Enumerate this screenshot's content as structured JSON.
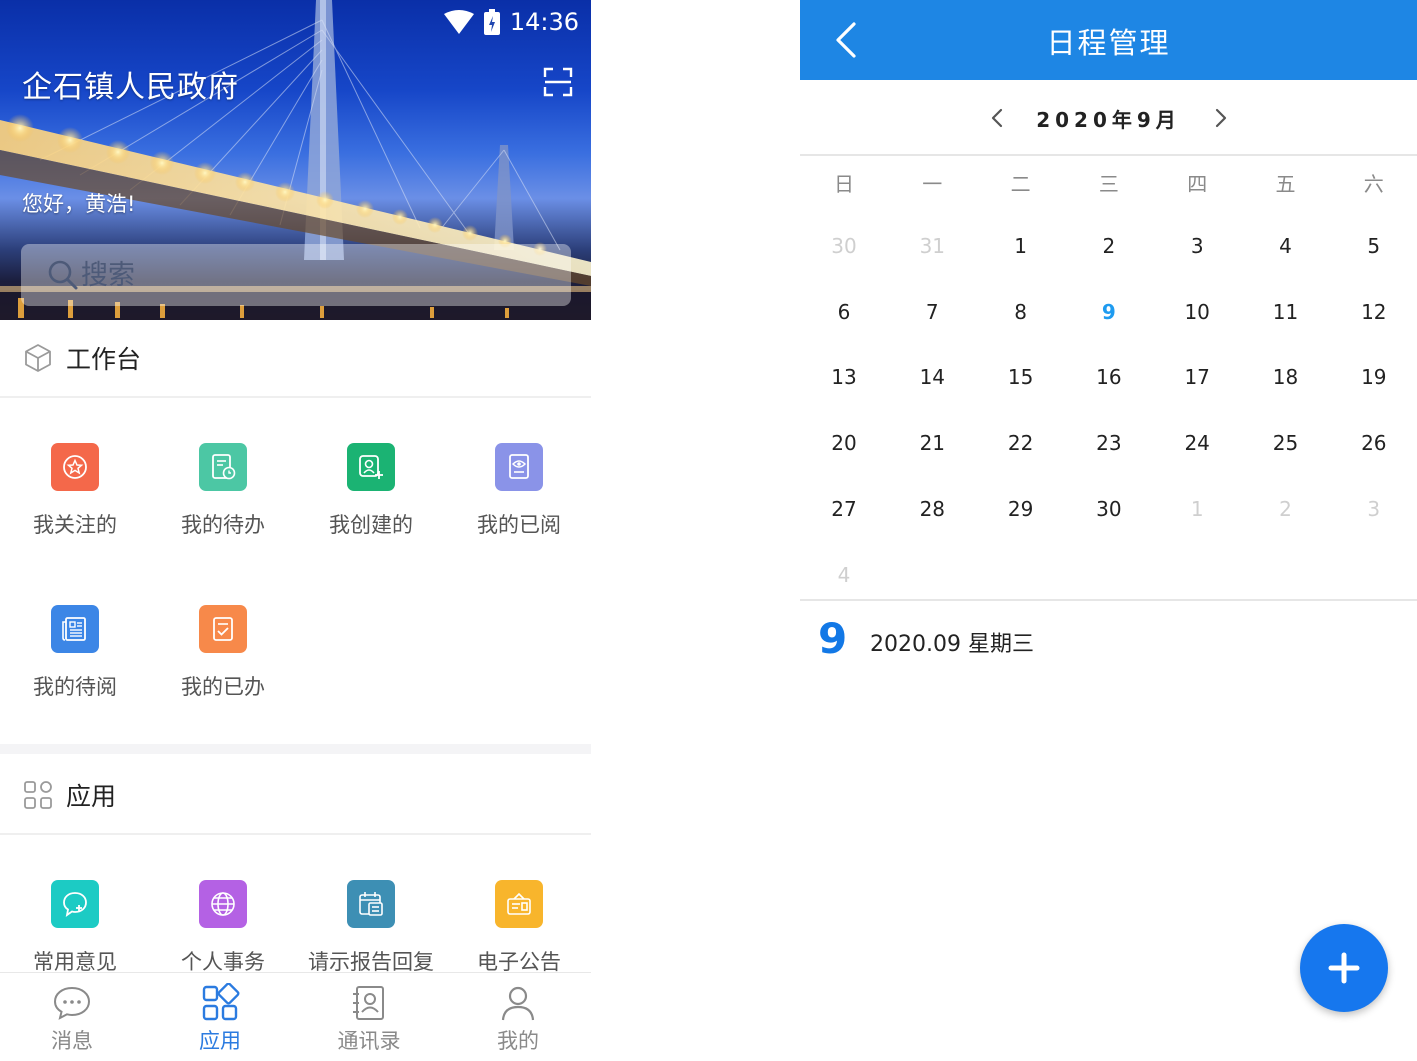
{
  "left": {
    "status": {
      "time": "14:36"
    },
    "org_title": "企石镇人民政府",
    "greeting": "您好，黄浩!",
    "search": {
      "placeholder": "搜索"
    },
    "workbench": {
      "title": "工作台",
      "items": [
        {
          "label": "我关注的",
          "icon": "star-badge-icon",
          "color": "#f4684a"
        },
        {
          "label": "我的待办",
          "icon": "doc-clock-icon",
          "color": "#4cc7a4"
        },
        {
          "label": "我创建的",
          "icon": "user-add-icon",
          "color": "#1bb373"
        },
        {
          "label": "我的已阅",
          "icon": "doc-eye-icon",
          "color": "#8a93e8"
        },
        {
          "label": "我的待阅",
          "icon": "newspaper-icon",
          "color": "#3c86e6"
        },
        {
          "label": "我的已办",
          "icon": "doc-check-icon",
          "color": "#f7894a"
        }
      ]
    },
    "apps": {
      "title": "应用",
      "items": [
        {
          "label": "常用意见",
          "icon": "chat-plus-icon",
          "color": "#1ccbc4"
        },
        {
          "label": "个人事务",
          "icon": "globe-icon",
          "color": "#b461e4"
        },
        {
          "label": "请示报告回复",
          "icon": "calendar-doc-icon",
          "color": "#3d8fb4"
        },
        {
          "label": "电子公告",
          "icon": "announcement-icon",
          "color": "#f8b52c"
        }
      ]
    },
    "tabs": [
      {
        "label": "消息",
        "icon": "message-icon",
        "active": false
      },
      {
        "label": "应用",
        "icon": "apps-grid-icon",
        "active": true
      },
      {
        "label": "通讯录",
        "icon": "contacts-icon",
        "active": false
      },
      {
        "label": "我的",
        "icon": "person-icon",
        "active": false
      }
    ]
  },
  "right": {
    "title": "日程管理",
    "month_label": "2020年9月",
    "weekdays": [
      "日",
      "一",
      "二",
      "三",
      "四",
      "五",
      "六"
    ],
    "weeks": [
      [
        "30",
        "31",
        "1",
        "2",
        "3",
        "4",
        "5"
      ],
      [
        "6",
        "7",
        "8",
        "9",
        "10",
        "11",
        "12"
      ],
      [
        "13",
        "14",
        "15",
        "16",
        "17",
        "18",
        "19"
      ],
      [
        "20",
        "21",
        "22",
        "23",
        "24",
        "25",
        "26"
      ],
      [
        "27",
        "28",
        "29",
        "30",
        "1",
        "2",
        "3"
      ],
      [
        "4"
      ]
    ],
    "muted_days": {
      "0": [
        0,
        1
      ],
      "4": [
        4,
        5,
        6
      ],
      "5": [
        0
      ]
    },
    "today": "9",
    "selected": {
      "day": "9",
      "date_text": "2020.09 星期三"
    },
    "colors": {
      "header": "#1e86e4",
      "today": "#1e9bf0",
      "fab": "#1677ee"
    }
  }
}
